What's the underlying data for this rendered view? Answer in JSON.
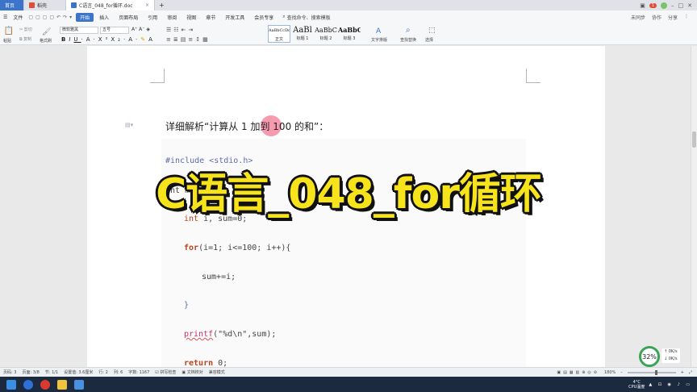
{
  "tabs": [
    {
      "label": "首页",
      "kind": "home"
    },
    {
      "label": "稻壳",
      "kind": "normal"
    },
    {
      "label": "C语言_048_for循环.doc",
      "kind": "active"
    }
  ],
  "tabbar_right": {
    "badge": "1"
  },
  "menu": {
    "file": "文件",
    "items": [
      "开始",
      "插入",
      "页面布局",
      "引用",
      "审阅",
      "视图",
      "章节",
      "开发工具",
      "会员专享"
    ],
    "active": "开始",
    "search": "查找命令、搜索模板",
    "right": [
      "未同步",
      "协作",
      "分享"
    ]
  },
  "ribbon": {
    "paste": "粘贴",
    "cut": "剪切",
    "copy": "复制",
    "format_painter": "格式刷",
    "font_name": "微软雅黑",
    "font_size": "五号",
    "styles": [
      {
        "preview": "AaBbCcDd",
        "label": "正文"
      },
      {
        "preview": "AaBl",
        "label": "标题 1"
      },
      {
        "preview": "AaBbC",
        "label": "标题 2"
      },
      {
        "preview": "AaBbC",
        "label": "标题 3"
      }
    ],
    "text_layout": "文字排版",
    "find_replace": "查找替换",
    "select": "选择"
  },
  "document": {
    "heading": "详细解析“计算从 1 加到 100 的和”：",
    "code_lines": [
      {
        "kind": "pre",
        "text": "#include <stdio.h>"
      },
      {
        "kind": "plain",
        "text": "int main(){"
      },
      {
        "kind": "decl",
        "kw": "int",
        "rest": " i, sum=0;"
      },
      {
        "kind": "for",
        "kw": "for",
        "rest": "(i=1; i<=100; i++){"
      },
      {
        "kind": "plain",
        "text": "sum+=i;"
      },
      {
        "kind": "brace",
        "text": "}"
      },
      {
        "kind": "fn",
        "fn": "printf",
        "rest": "(\"%d\\n\",sum);"
      },
      {
        "kind": "ret",
        "kw": "return",
        "rest": " 0;"
      }
    ]
  },
  "overlay_title": "C语言_048_for循环",
  "perf": {
    "percent": "32%",
    "up": "0K/s",
    "down": "0K/s"
  },
  "statusbar": {
    "items": [
      "页码: 3",
      "页面: 3/8",
      "节: 1/1",
      "设置值: 3.6厘米",
      "行: 2",
      "列: 6",
      "字数: 1167",
      "拼写检查",
      "文档校对",
      "兼容模式"
    ],
    "zoom": "180%"
  },
  "taskbar": {
    "temp": "4°C",
    "cpu": "CPU温度"
  },
  "colors": {
    "accent": "#3b74c9",
    "overlay": "#f6e31c",
    "keyword": "#b8451f"
  }
}
